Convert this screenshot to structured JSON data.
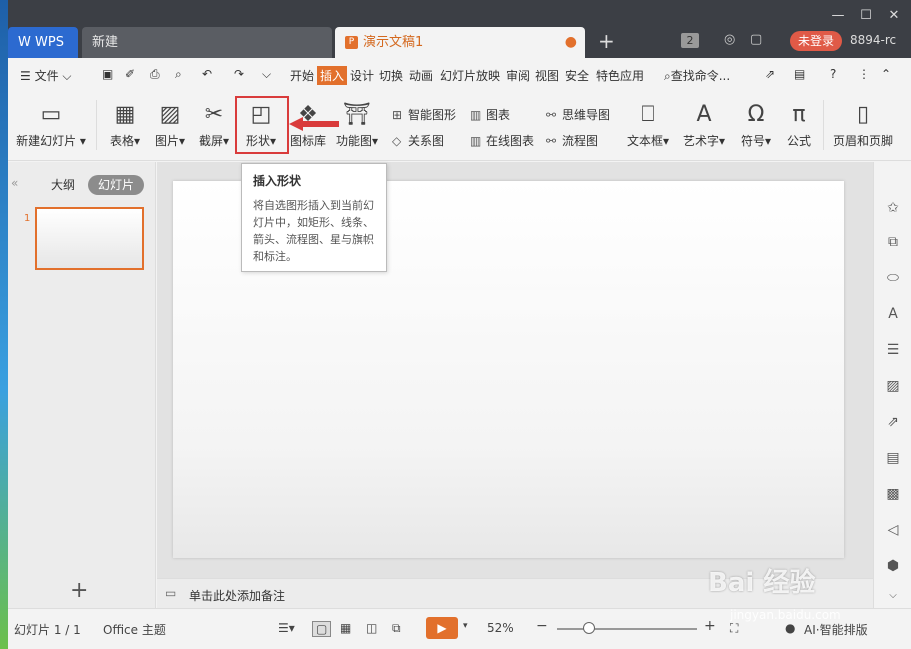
{
  "titlebar": {
    "wps_tab": "WPS",
    "new_tab": "新建",
    "doc_tab": "演示文稿1",
    "doc_icon": "P",
    "modified_dot": "●",
    "add_tab": "+",
    "window_count": "2",
    "login": "未登录",
    "user": "8894-rc"
  },
  "menubar": {
    "file": "文件",
    "items": [
      "开始",
      "插入",
      "设计",
      "切换",
      "动画",
      "幻灯片放映",
      "审阅",
      "视图",
      "安全",
      "特色应用"
    ],
    "active": "插入",
    "search": "查找命令..."
  },
  "ribbon": {
    "new_slide": "新建幻灯片",
    "table": "表格",
    "picture": "图片",
    "screenshot": "截屏",
    "shape": "形状",
    "icon_lib": "图标库",
    "func_chart": "功能图",
    "smart_art": "智能图形",
    "chart": "图表",
    "relation": "关系图",
    "online_chart": "在线图表",
    "mindmap": "思维导图",
    "flowchart": "流程图",
    "textbox": "文本框",
    "wordart": "艺术字",
    "symbol": "符号",
    "formula": "公式",
    "header_footer": "页眉和页脚"
  },
  "tooltip": {
    "title": "插入形状",
    "desc": "将自选图形插入到当前幻灯片中，如矩形、线条、箭头、流程图、星与旗帜和标注。"
  },
  "panel": {
    "outline_tab": "大纲",
    "slides_tab": "幻灯片",
    "slide_num": "1",
    "collapse": "«",
    "add": "+"
  },
  "notes": {
    "placeholder": "单击此处添加备注"
  },
  "status": {
    "slide_info": "幻灯片 1 / 1",
    "theme": "Office 主题",
    "zoom": "52%",
    "ai": "AI·智能排版"
  },
  "watermark": {
    "brand": "Bai 经验",
    "url": "jingyan.baidu.com"
  },
  "colors": {
    "accent": "#e2702c",
    "highlight": "#d93b3b"
  }
}
